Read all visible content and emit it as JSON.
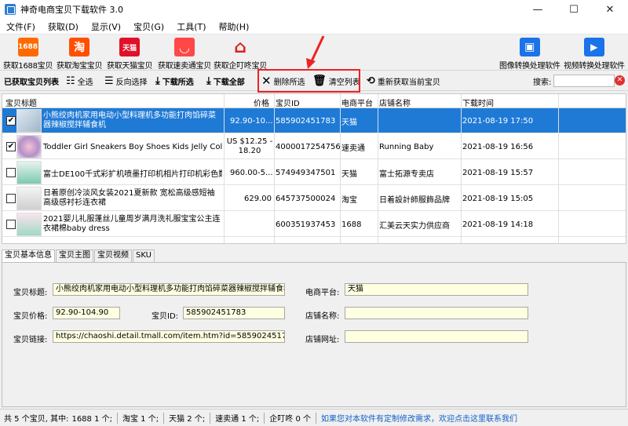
{
  "window": {
    "title": "神奇电商宝贝下载软件 3.0",
    "minimize": "—",
    "maximize": "☐",
    "close": "✕"
  },
  "menu": [
    "文件(F)",
    "获取(D)",
    "显示(V)",
    "宝贝(G)",
    "工具(T)",
    "帮助(H)"
  ],
  "toolbar1": [
    {
      "label": "获取1688宝贝",
      "icon": "1688-icon",
      "badge": "1688",
      "color": "#ff6a00"
    },
    {
      "label": "获取淘宝宝贝",
      "icon": "taobao-icon",
      "badge": "淘",
      "color": "#ff5000"
    },
    {
      "label": "获取天猫宝贝",
      "icon": "tmall-icon",
      "badge": "天猫",
      "color": "#e0102a"
    },
    {
      "label": "获取速卖通宝贝",
      "icon": "aliexpress-icon",
      "badge": "◡",
      "color": "#ff4747"
    },
    {
      "label": "获取企叮咚宝贝",
      "icon": "qidingdong-icon",
      "badge": "⌂",
      "color": "#e02020"
    },
    {
      "label": "图像转换处理软件",
      "icon": "image-convert-icon",
      "badge": "▣",
      "color": "#1a73e8"
    },
    {
      "label": "视频转换处理软件",
      "icon": "video-convert-icon",
      "badge": "▶",
      "color": "#1a73e8"
    }
  ],
  "toolbar2": {
    "list_label": "已获取宝贝列表",
    "select_all": "全选",
    "invert": "反向选择",
    "download_selected": "下载所选",
    "download_all": "下载全部",
    "delete_selected": "删除所选",
    "clear_list": "清空列表",
    "refetch": "重新获取当前宝贝",
    "search_label": "搜索:",
    "search_value": ""
  },
  "table": {
    "headers": [
      "宝贝标题",
      "价格",
      "宝贝ID",
      "电商平台",
      "店铺名称",
      "下载时间"
    ],
    "rows": [
      {
        "checked": true,
        "selected": true,
        "title": "小熊绞肉机家用电动小型料理机多功能打肉馅碎菜器辣椒搅拌辅食机",
        "price": "92.90-10...",
        "id": "585902451783",
        "platform": "天猫",
        "shop": "",
        "time": "2021-08-19 17:50"
      },
      {
        "checked": true,
        "selected": false,
        "title": "Toddler Girl Sneakers Boy Shoes Kids Jelly Color Ca...",
        "price": "US $12.25 - 18.20",
        "id": "4000017254756",
        "platform": "速卖通",
        "shop": "Running Baby",
        "time": "2021-08-19 16:56"
      },
      {
        "checked": false,
        "selected": false,
        "title": "富士DE100千式彩扩机喷墨打印机相片打印机彩色数...",
        "price": "960.00-5...",
        "id": "574949347501",
        "platform": "天猫",
        "shop": "富士拓源专卖店",
        "time": "2021-08-19 15:57"
      },
      {
        "checked": false,
        "selected": false,
        "title": "日着原创冷淡风女装2021夏新款 宽松高级感短袖高级感衬衫连衣裙",
        "price": "629.00",
        "id": "645737500024",
        "platform": "淘宝",
        "shop": "日着設計師服飾品牌",
        "time": "2021-08-19 15:05"
      },
      {
        "checked": false,
        "selected": false,
        "title": "2021婴儿礼服蓬丝儿童周岁满月洗礼服宝宝公主连衣裙棉baby dress",
        "price": "",
        "id": "600351937453",
        "platform": "1688",
        "shop": "汇美云天实力供应商",
        "time": "2021-08-19 14:18"
      }
    ]
  },
  "tabs": [
    "宝贝基本信息",
    "宝贝主图",
    "宝贝视频",
    "SKU"
  ],
  "detail": {
    "title_label": "宝贝标题:",
    "title_value": "小熊绞肉机家用电动小型料理机多功能打肉馅碎菜器辣椒搅拌辅食机",
    "platform_label": "电商平台:",
    "platform_value": "天猫",
    "price_label": "宝贝价格:",
    "price_value": "92.90-104.90",
    "id_label": "宝贝ID:",
    "id_value": "585902451783",
    "shop_label": "店铺名称:",
    "shop_value": "",
    "link_label": "宝贝链接:",
    "link_value": "https://chaoshi.detail.tmall.com/item.htm?id=585902451783",
    "shopurl_label": "店铺网址:",
    "shopurl_value": ""
  },
  "status": {
    "total": "共 5 个宝贝, 其中:",
    "c1688": "1688 1 个;",
    "taobao": "淘宝 1 个;",
    "tmall": "天猫 2 个;",
    "aliexpress": "速卖通 1 个;",
    "qdd": "企叮咚 0 个",
    "contact": "如果您对本软件有定制修改需求，欢迎点击这里联系我们"
  }
}
